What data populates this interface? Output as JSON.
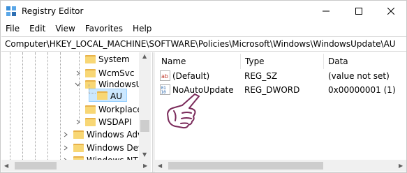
{
  "window": {
    "title": "Registry Editor",
    "app_icon": "registry-editor-icon"
  },
  "window_buttons": [
    "minimize-icon",
    "maximize-icon",
    "close-icon"
  ],
  "menu": [
    "File",
    "Edit",
    "View",
    "Favorites",
    "Help"
  ],
  "address": "Computer\\HKEY_LOCAL_MACHINE\\SOFTWARE\\Policies\\Microsoft\\Windows\\WindowsUpdate\\AU",
  "tree": {
    "items": [
      {
        "label": "System"
      },
      {
        "label": "WcmSvc"
      },
      {
        "label": "WindowsUpdate"
      },
      {
        "label": "AU",
        "selected": true
      },
      {
        "label": "WorkplaceJoin"
      },
      {
        "label": "WSDAPI"
      },
      {
        "label": "Windows Advanced Threat Protection"
      },
      {
        "label": "Windows Defender"
      },
      {
        "label": "Windows NT"
      }
    ]
  },
  "list": {
    "columns": [
      "Name",
      "Type",
      "Data"
    ],
    "rows": [
      {
        "name": "(Default)",
        "type": "REG_SZ",
        "data": "(value not set)",
        "icon": "string-value-icon"
      },
      {
        "name": "NoAutoUpdate",
        "type": "REG_DWORD",
        "data": "0x00000001 (1)",
        "icon": "dword-value-icon"
      }
    ]
  },
  "overlay": {
    "icon": "pointing-hand-cursor-icon"
  },
  "colors": {
    "folder": "#f8d775",
    "folder_dark": "#e8b24a",
    "selection": "#cce8ff",
    "selection_border": "#99d1ff",
    "accent": "#0078d7"
  }
}
